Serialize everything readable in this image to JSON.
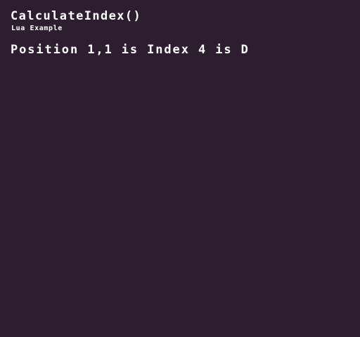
{
  "header": {
    "title": "CalculateIndex()",
    "subtitle": "Lua Example"
  },
  "output": {
    "line": "Position 1,1 is Index 4 is D"
  },
  "colors": {
    "background": "#2d1e2f",
    "text": "#ffffff"
  }
}
